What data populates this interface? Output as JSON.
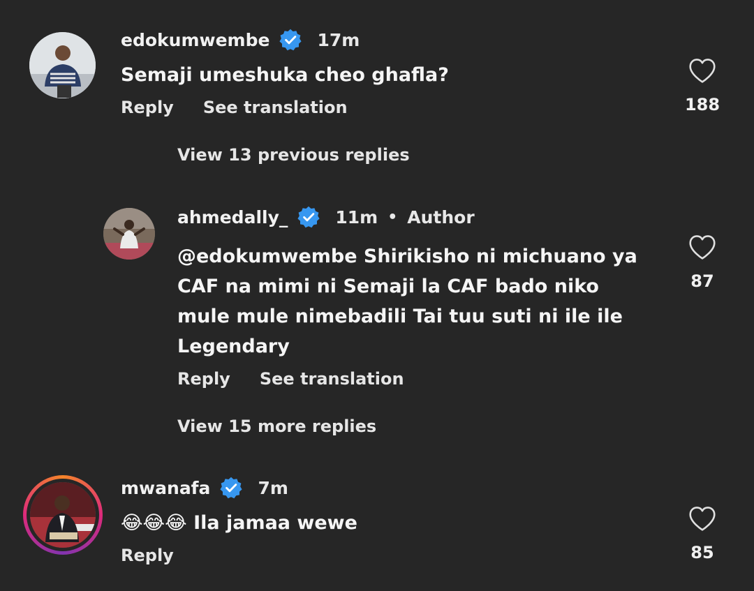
{
  "colors": {
    "background": "#262626",
    "verified": "#3797f0",
    "text": "#f2f2f2"
  },
  "comments": [
    {
      "username": "edokumwembe",
      "verified_icon": "verified-badge-icon",
      "time": "17m",
      "text": "Semaji umeshuka cheo ghafla?",
      "reply_label": "Reply",
      "translate_label": "See translation",
      "likes": "188",
      "view_replies": "View 13 previous replies"
    },
    {
      "username": "ahmedally_",
      "verified_icon": "verified-badge-icon",
      "time": "11m",
      "separator": "•",
      "author_label": "Author",
      "text_lines": [
        "@edokumwembe Shirikisho ni michuano ya",
        "CAF na mimi ni Semaji la CAF bado niko",
        "mule mule nimebadili Tai tuu suti ni ile ile",
        "Legendary"
      ],
      "reply_label": "Reply",
      "translate_label": "See translation",
      "likes": "87",
      "view_replies": "View 15 more replies"
    },
    {
      "username": "mwanafa",
      "verified_icon": "verified-badge-icon",
      "time": "7m",
      "emojis": "😂😂😂",
      "text": "Ila jamaa wewe",
      "reply_label": "Reply",
      "likes": "85"
    }
  ]
}
